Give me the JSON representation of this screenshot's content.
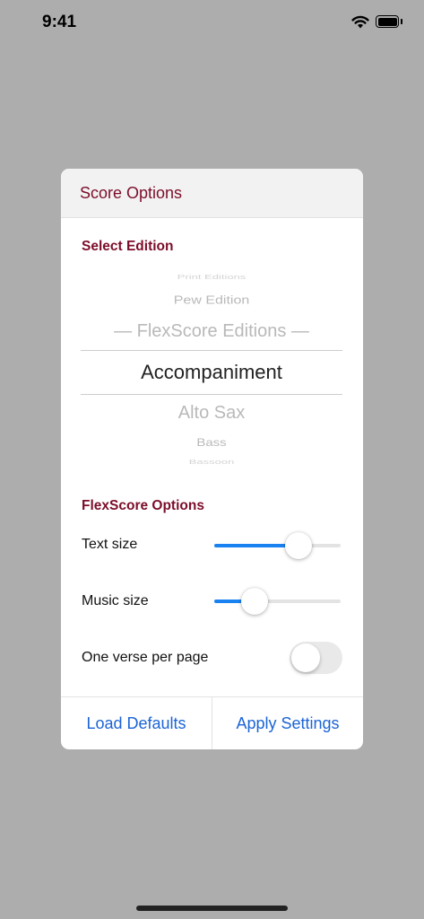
{
  "status_bar": {
    "time": "9:41",
    "icons": [
      "wifi-icon",
      "battery-icon"
    ]
  },
  "dialog": {
    "title": "Score Options",
    "select_edition": {
      "heading": "Select Edition",
      "picker_items": [
        "Print Editions",
        "Pew Edition",
        "— FlexScore Editions —",
        "Accompaniment",
        "Alto Sax",
        "Bass",
        "Bassoon"
      ],
      "selected": "Accompaniment"
    },
    "flexscore_options": {
      "heading": "FlexScore Options",
      "text_size": {
        "label": "Text size",
        "value": 0.67
      },
      "music_size": {
        "label": "Music size",
        "value": 0.32
      },
      "one_verse": {
        "label": "One verse per page",
        "on": false
      }
    },
    "buttons": {
      "load_defaults": "Load Defaults",
      "apply_settings": "Apply Settings"
    }
  },
  "colors": {
    "accent": "#7c0d2a",
    "link": "#1b64d6",
    "slider": "#1a82f0",
    "overlay": "#adadad"
  }
}
